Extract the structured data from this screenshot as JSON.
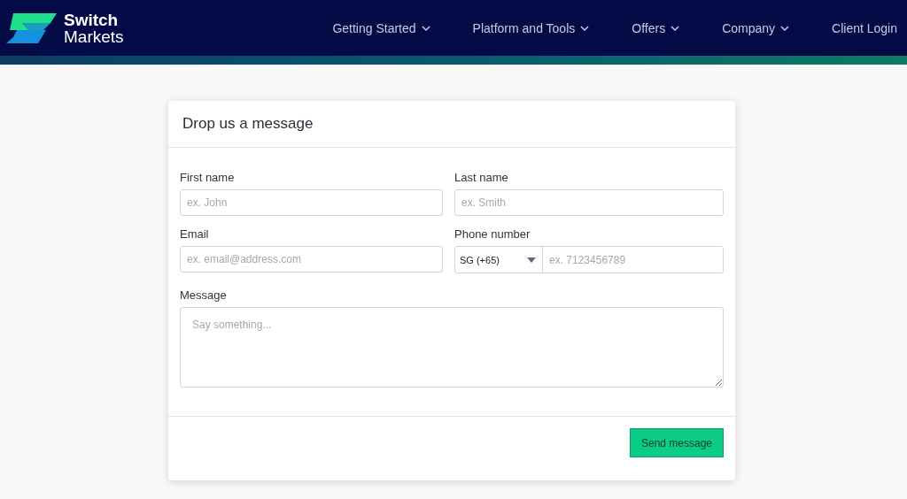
{
  "brand": {
    "line_1": "Switch",
    "line_2": "Markets"
  },
  "nav": [
    {
      "label": "Getting Started",
      "has_menu": true
    },
    {
      "label": "Platform and Tools",
      "has_menu": true
    },
    {
      "label": "Offers",
      "has_menu": true
    },
    {
      "label": "Company",
      "has_menu": true
    },
    {
      "label": "Client Login",
      "has_menu": false
    }
  ],
  "form": {
    "title": "Drop us a message",
    "first_name": {
      "label": "First name",
      "placeholder": "ex. John"
    },
    "last_name": {
      "label": "Last name",
      "placeholder": "ex. Smith"
    },
    "email": {
      "label": "Email",
      "placeholder": "ex. email@address.com"
    },
    "phone": {
      "label": "Phone number",
      "country": "SG (+65)",
      "placeholder": "ex. 7123456789"
    },
    "message": {
      "label": "Message",
      "placeholder": "Say something..."
    },
    "submit": "Send message"
  }
}
